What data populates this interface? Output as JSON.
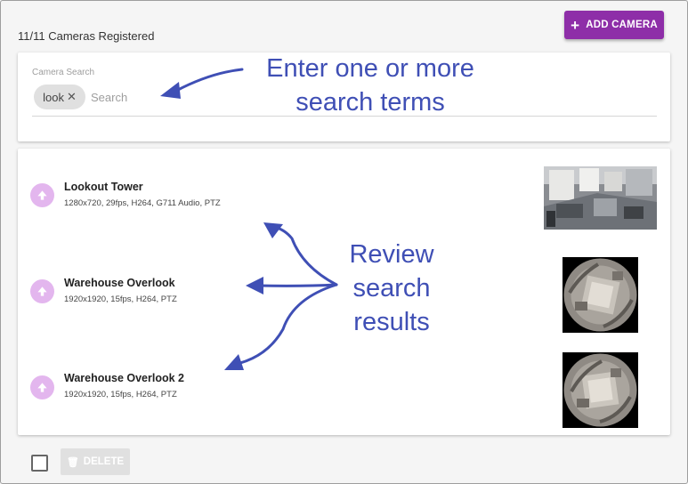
{
  "header": {
    "count_label": "11/11 Cameras Registered",
    "add_button_label": "ADD CAMERA",
    "accent_color": "#8e2ea8"
  },
  "search": {
    "label": "Camera Search",
    "chip_text": "look",
    "placeholder": "Search",
    "value": ""
  },
  "cameras": [
    {
      "name": "Lookout Tower",
      "details": "1280x720, 29fps, H264, G711 Audio, PTZ",
      "icon": "arrow-up-icon",
      "thumbnail": "interior-room-view"
    },
    {
      "name": "Warehouse Overlook",
      "details": "1920x1920, 15fps, H264, PTZ",
      "icon": "arrow-up-icon",
      "thumbnail": "fisheye-warehouse-view"
    },
    {
      "name": "Warehouse Overlook 2",
      "details": "1920x1920, 15fps, H264, PTZ",
      "icon": "arrow-up-icon",
      "thumbnail": "fisheye-warehouse-view"
    }
  ],
  "footer": {
    "delete_label": "DELETE"
  },
  "annotations": {
    "search_line1": "Enter one or more",
    "search_line2": "search terms",
    "results_line1": "Review",
    "results_line2": "search",
    "results_line3": "results",
    "color": "#3f4fb5"
  }
}
